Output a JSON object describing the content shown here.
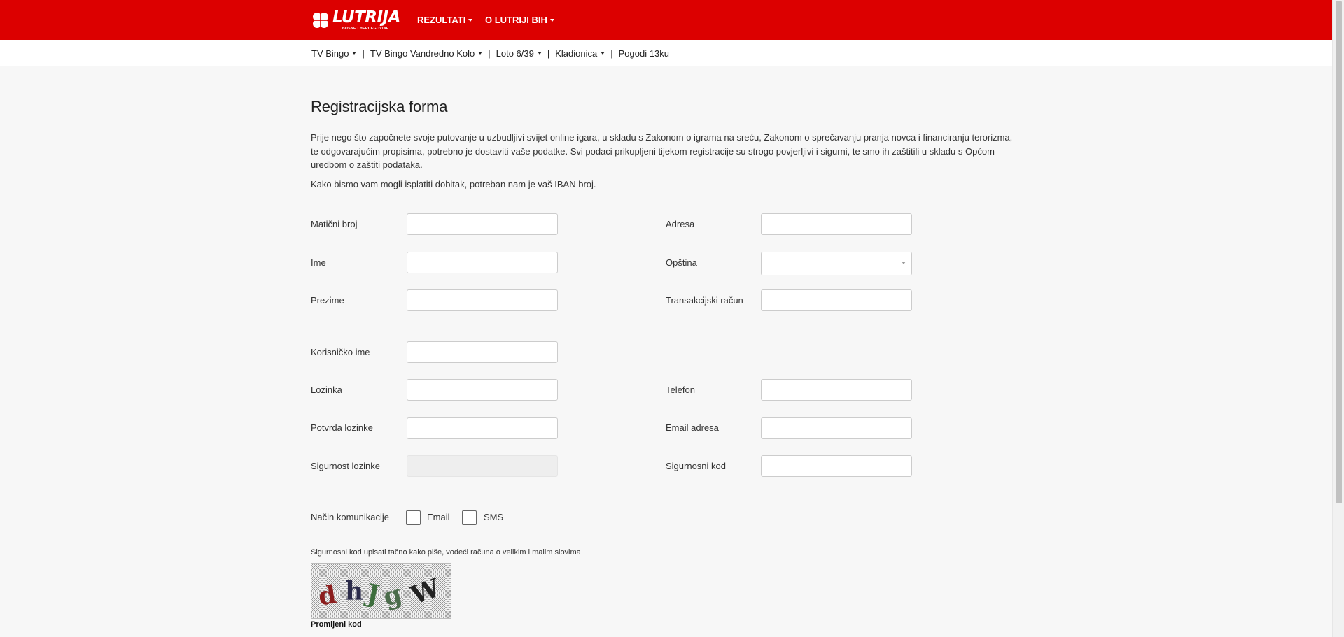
{
  "brand": {
    "name": "LUTRIJA",
    "tagline": "BOSNE I HERCEGOVINE"
  },
  "topnav": {
    "items": [
      "REZULTATI",
      "O LUTRIJI BIH"
    ]
  },
  "subnav": {
    "items": [
      {
        "label": "TV Bingo",
        "has_dropdown": true
      },
      {
        "label": "TV Bingo Vandredno Kolo",
        "has_dropdown": true
      },
      {
        "label": "Loto 6/39",
        "has_dropdown": true
      },
      {
        "label": "Kladionica",
        "has_dropdown": true
      },
      {
        "label": "Pogodi 13ku",
        "has_dropdown": false
      }
    ],
    "separator": "|"
  },
  "form": {
    "title": "Registracijska forma",
    "intro": "Prije nego što započnete svoje putovanje u uzbudljivi svijet online igara, u skladu s Zakonom o igrama na sreću, Zakonom o sprečavanju pranja novca i financiranju terorizma, te odgovarajućim propisima, potrebno je dostaviti vaše podatke. Svi podaci prikupljeni tijekom registracije su strogo povjerljivi i sigurni, te smo ih zaštitili u skladu s Općom uredbom o zaštiti podataka.",
    "iban_note": "Kako bismo vam mogli isplatiti dobitak, potreban nam je vaš IBAN broj.",
    "fields": {
      "maticni_broj": {
        "label": "Matični broj",
        "value": ""
      },
      "adresa": {
        "label": "Adresa",
        "value": ""
      },
      "ime": {
        "label": "Ime",
        "value": ""
      },
      "opstina": {
        "label": "Opština",
        "value": ""
      },
      "prezime": {
        "label": "Prezime",
        "value": ""
      },
      "transakcijski_racun": {
        "label": "Transakcijski račun",
        "value": ""
      },
      "korisnicko_ime": {
        "label": "Korisničko ime",
        "value": ""
      },
      "lozinka": {
        "label": "Lozinka",
        "value": ""
      },
      "telefon": {
        "label": "Telefon",
        "value": ""
      },
      "potvrda_lozinke": {
        "label": "Potvrda lozinke",
        "value": ""
      },
      "email_adresa": {
        "label": "Email adresa",
        "value": ""
      },
      "sigurnost_lozinke": {
        "label": "Sigurnost lozinke",
        "value": ""
      },
      "sigurnosni_kod": {
        "label": "Sigurnosni kod",
        "value": ""
      }
    },
    "communication": {
      "label": "Način komunikacije",
      "options": [
        {
          "label": "Email",
          "checked": false
        },
        {
          "label": "SMS",
          "checked": false
        }
      ]
    },
    "captcha": {
      "note": "Sigurnosni kod upisati tačno kako piše, vodeći računa o velikim i malim slovima",
      "text": "d hJg W",
      "change_label": "Promijeni kod"
    }
  },
  "colors": {
    "brand_red": "#dc0000",
    "page_bg": "#f7f7f7"
  }
}
